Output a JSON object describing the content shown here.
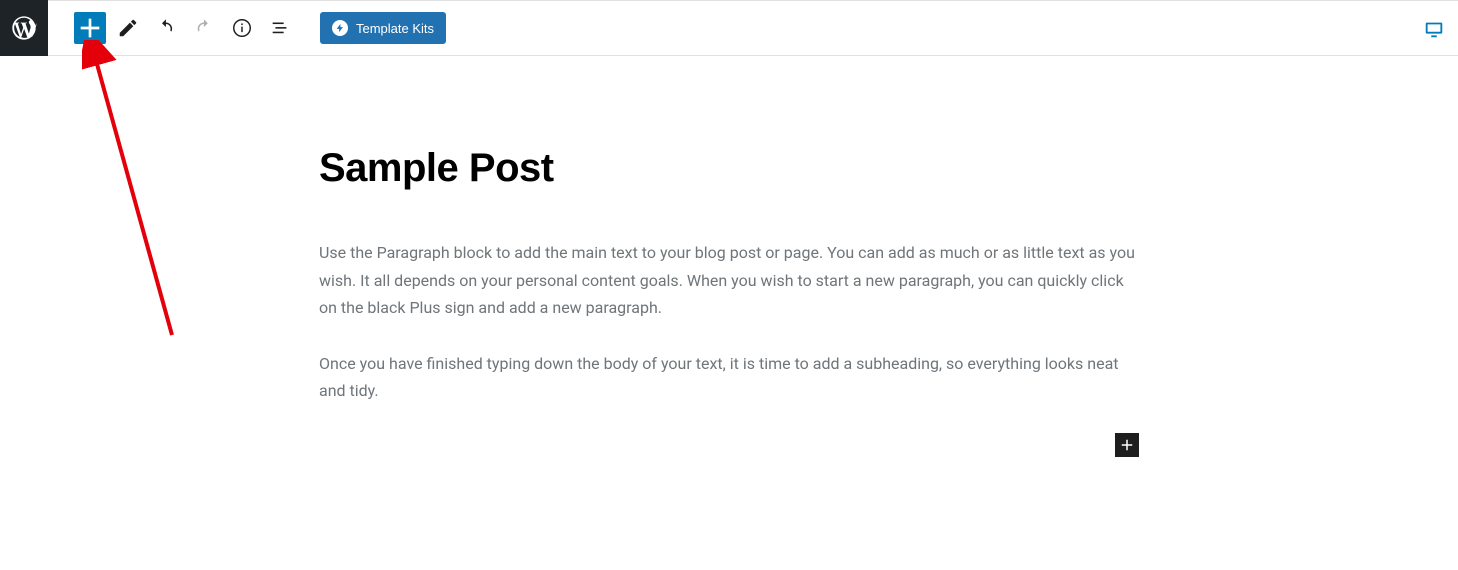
{
  "toolbar": {
    "template_kits_label": "Template Kits"
  },
  "post": {
    "title": "Sample Post",
    "paragraphs": [
      "Use the Paragraph block to add the main text to your blog post or page. You can add as much or as little text as you wish. It all depends on your personal content goals. When you wish to start a new paragraph, you can quickly click on the black Plus sign and add a new paragraph.",
      "Once you have finished typing down the body of your text, it is time to add a subheading, so everything looks neat and tidy."
    ]
  }
}
